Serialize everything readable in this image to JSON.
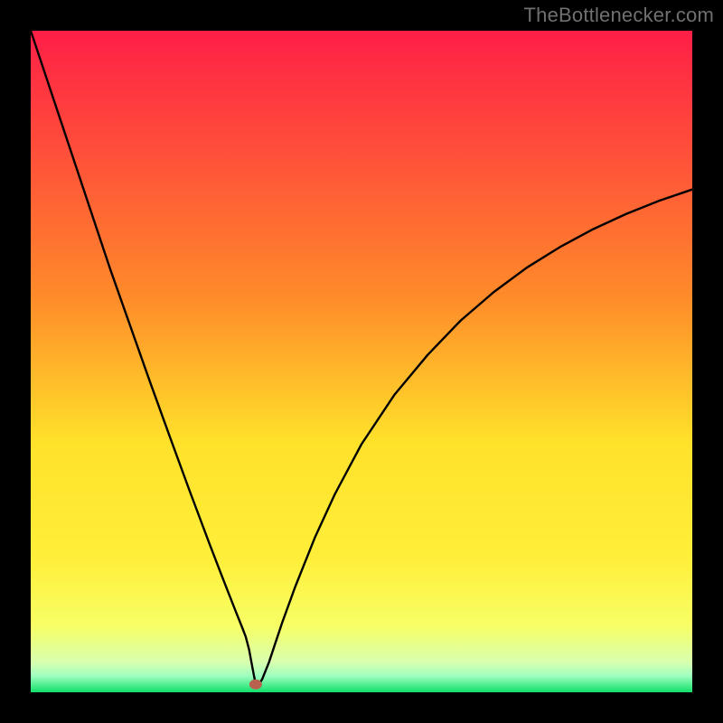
{
  "watermark": "TheBottlenecker.com",
  "chart_data": {
    "type": "line",
    "title": "",
    "xlabel": "",
    "ylabel": "",
    "xlim": [
      0,
      100
    ],
    "ylim": [
      0,
      100
    ],
    "grid": false,
    "legend": false,
    "gradient_colors": {
      "top": "#ff1f47",
      "mid_upper": "#ff8a2a",
      "mid": "#ffe12a",
      "mid_lower": "#f7ff66",
      "bottom": "#11e06a"
    },
    "marker": {
      "x": 34,
      "y": 1.2,
      "color": "#b9604f"
    },
    "series": [
      {
        "name": "curve",
        "x": [
          0,
          3,
          6,
          9,
          12,
          15,
          18,
          21,
          24,
          27,
          29,
          31,
          32,
          32.5,
          33,
          33.5,
          34,
          34.5,
          35,
          36,
          38,
          40,
          43,
          46,
          50,
          55,
          60,
          65,
          70,
          75,
          80,
          85,
          90,
          95,
          100
        ],
        "y": [
          100,
          91,
          82,
          73,
          64,
          55.5,
          47,
          38.7,
          30.5,
          22.5,
          17.3,
          12.2,
          9.7,
          8.4,
          6.5,
          3.8,
          1.2,
          1.2,
          2.0,
          4.5,
          10.5,
          16.0,
          23.5,
          30.0,
          37.5,
          45.0,
          51.0,
          56.2,
          60.5,
          64.2,
          67.3,
          70.0,
          72.3,
          74.3,
          76.0
        ]
      }
    ]
  }
}
